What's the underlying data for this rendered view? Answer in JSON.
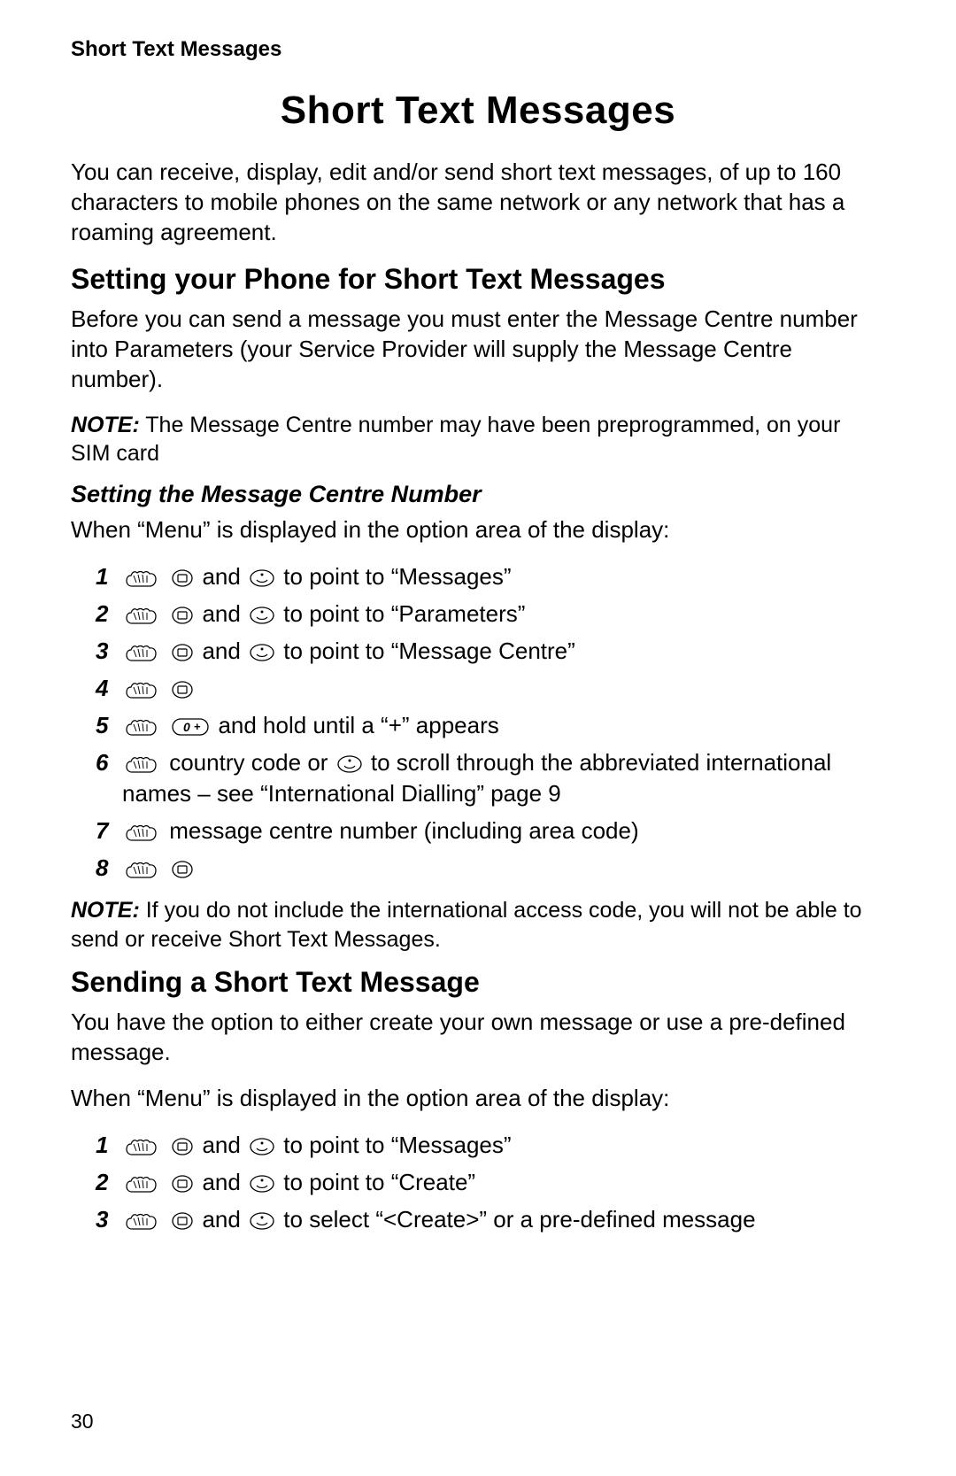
{
  "running_header": "Short Text Messages",
  "title": "Short Text Messages",
  "intro": "You can receive, display, edit and/or send short text messages, of up to 160 characters to mobile phones on the same network or any network that has a roaming agreement.",
  "section1": {
    "heading": "Setting your Phone for Short Text Messages",
    "para": "Before you can send a message you must enter the Message Centre number into Parameters (your Service Provider will supply the Message Centre number).",
    "note_label": "NOTE:",
    "note_text": " The Message Centre number may have been preprogrammed, on your SIM card",
    "sub_heading": "Setting the Message Centre Number",
    "sub_intro": "When “Menu” is displayed in the option area of the display:",
    "steps": [
      {
        "n": "1",
        "a": " and ",
        "b": " to point to “Messages”"
      },
      {
        "n": "2",
        "a": " and ",
        "b": " to point to “Parameters”"
      },
      {
        "n": "3",
        "a": " and ",
        "b": " to point to “Message Centre”"
      },
      {
        "n": "4"
      },
      {
        "n": "5",
        "c": " and hold until a “+” appears"
      },
      {
        "n": "6",
        "d": " country code or ",
        "e": " to scroll through the abbreviated international names – see “International Dialling” page 9"
      },
      {
        "n": "7",
        "f": " message centre number (including area code)"
      },
      {
        "n": "8"
      }
    ],
    "note2_label": "NOTE:",
    "note2_text": " If you do not include the international access code, you will not be able to send or receive Short Text Messages."
  },
  "section2": {
    "heading": "Sending a Short Text Message",
    "para1": "You have the option to either create your own message or use a pre-defined message.",
    "para2": "When “Menu” is displayed in the option area of the display:",
    "steps": [
      {
        "n": "1",
        "a": " and ",
        "b": " to point to “Messages”"
      },
      {
        "n": "2",
        "a": " and ",
        "b": " to point to “Create”"
      },
      {
        "n": "3",
        "a": " and ",
        "b": " to select  “<Create>” or a pre-defined message"
      }
    ]
  },
  "page_number": "30"
}
